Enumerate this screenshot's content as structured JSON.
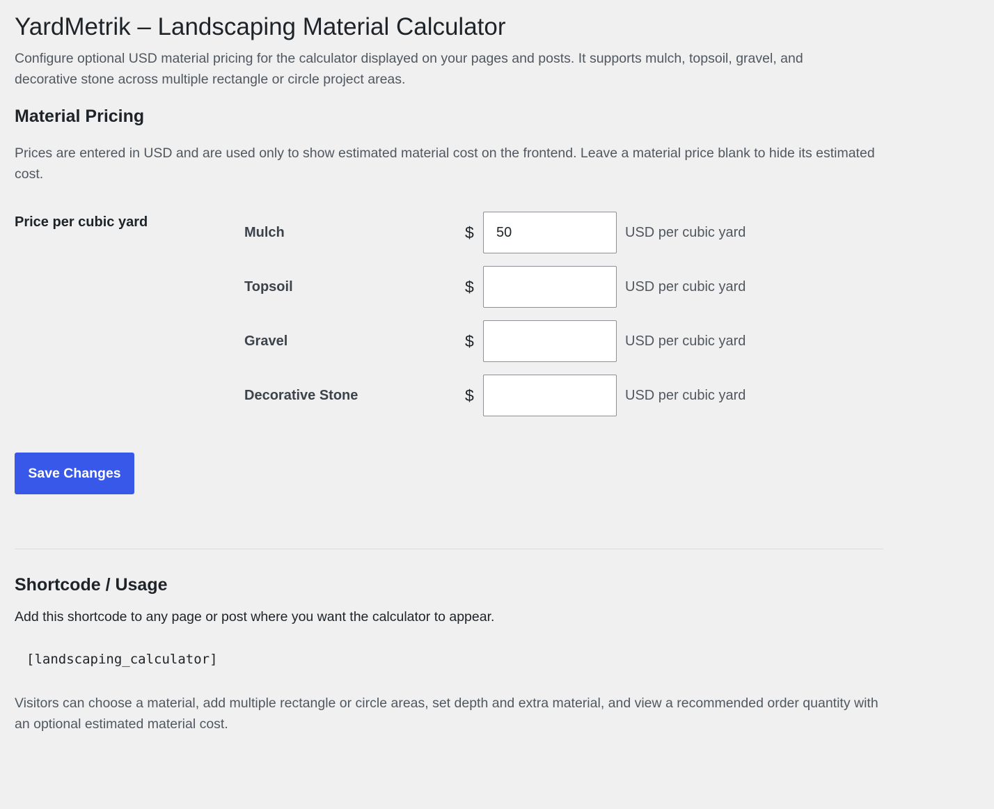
{
  "header": {
    "title": "YardMetrik – Landscaping Material Calculator",
    "description": "Configure optional USD material pricing for the calculator displayed on your pages and posts. It supports mulch, topsoil, gravel, and decorative stone across multiple rectangle or circle project areas."
  },
  "pricing": {
    "title": "Material Pricing",
    "description": "Prices are entered in USD and are used only to show estimated material cost on the frontend. Leave a material price blank to hide its estimated cost.",
    "row_label": "Price per cubic yard",
    "currency_symbol": "$",
    "unit_label": "USD per cubic yard",
    "materials": [
      {
        "name": "Mulch",
        "value": "50"
      },
      {
        "name": "Topsoil",
        "value": ""
      },
      {
        "name": "Gravel",
        "value": ""
      },
      {
        "name": "Decorative Stone",
        "value": ""
      }
    ]
  },
  "actions": {
    "save_label": "Save Changes"
  },
  "usage": {
    "title": "Shortcode / Usage",
    "description": "Add this shortcode to any page or post where you want the calculator to appear.",
    "shortcode": "[landscaping_calculator]",
    "visitors_description": "Visitors can choose a material, add multiple rectangle or circle areas, set depth and extra material, and view a recommended order quantity with an optional estimated material cost."
  },
  "colors": {
    "background": "#f0f0f1",
    "accent": "#3858e9"
  }
}
